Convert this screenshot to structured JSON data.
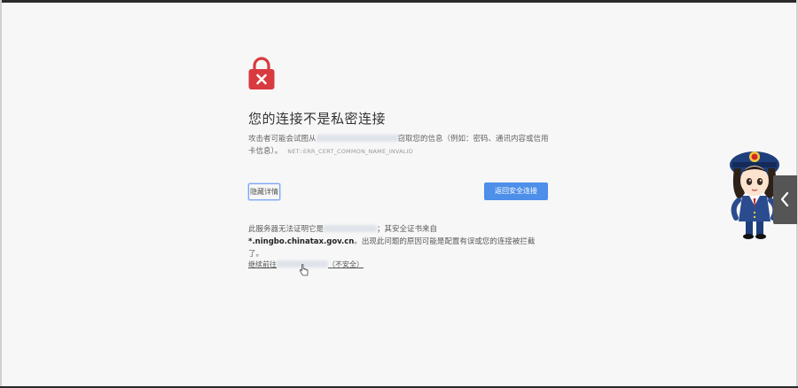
{
  "page": {
    "heading": "您的连接不是私密连接",
    "desc_prefix": "攻击者可能会试图从",
    "desc_suffix": "窃取您的信息（例如：密码、通讯内容或信用卡信息）。",
    "error_code": "NET::ERR_CERT_COMMON_NAME_INVALID",
    "details_button": "隐藏详情",
    "back_button": "返回安全连接",
    "explain_prefix": "此服务器无法证明它是",
    "explain_mid": "；其安全证书来自",
    "explain_domain": "*.ningbo.chinatax.gov.cn",
    "explain_suffix": "。出现此问题的原因可能是配置有误或您的连接被拦截了。",
    "proceed_prefix": "继续前往",
    "proceed_suffix": "（不安全）"
  },
  "colors": {
    "lock": "#d93a3f",
    "button_primary": "#4d8fe9",
    "side_toggle": "#555555"
  },
  "icons": [
    "lock-icon",
    "cursor-icon",
    "chevron-left-icon",
    "mascot-image"
  ]
}
